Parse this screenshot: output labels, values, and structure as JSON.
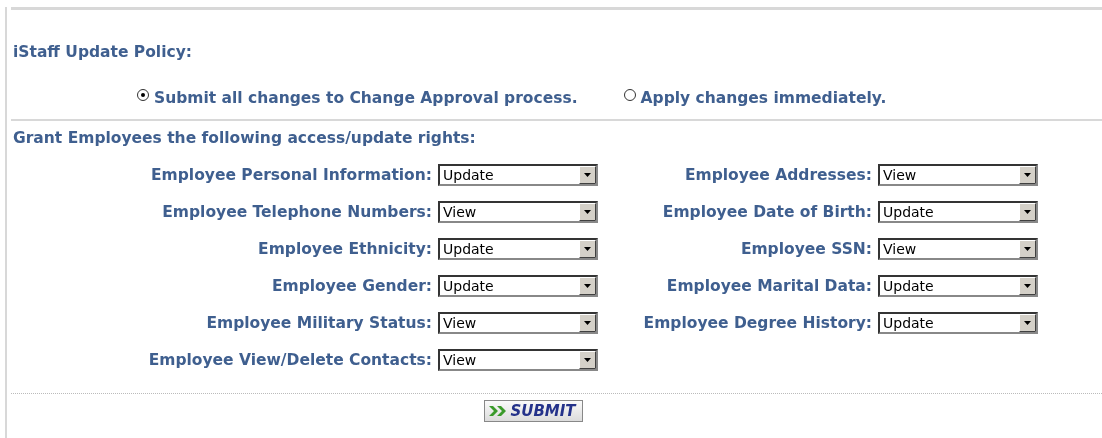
{
  "policy": {
    "heading": "iStaff Update Policy:",
    "options": [
      {
        "label": "Submit all changes to Change Approval process.",
        "selected": true
      },
      {
        "label": "Apply changes immediately.",
        "selected": false
      }
    ]
  },
  "rights": {
    "heading": "Grant Employees the following access/update rights:",
    "fields": [
      {
        "label": "Employee Personal Information:",
        "value": "Update"
      },
      {
        "label": "Employee Addresses:",
        "value": "View"
      },
      {
        "label": "Employee Telephone Numbers:",
        "value": "View"
      },
      {
        "label": "Employee Date of Birth:",
        "value": "Update"
      },
      {
        "label": "Employee Ethnicity:",
        "value": "Update"
      },
      {
        "label": "Employee SSN:",
        "value": "View"
      },
      {
        "label": "Employee Gender:",
        "value": "Update"
      },
      {
        "label": "Employee Marital Data:",
        "value": "Update"
      },
      {
        "label": "Employee Military Status:",
        "value": "View"
      },
      {
        "label": "Employee Degree History:",
        "value": "Update"
      },
      {
        "label": "Employee View/Delete Contacts:",
        "value": "View"
      }
    ]
  },
  "submit": {
    "label": "SUBMIT"
  }
}
